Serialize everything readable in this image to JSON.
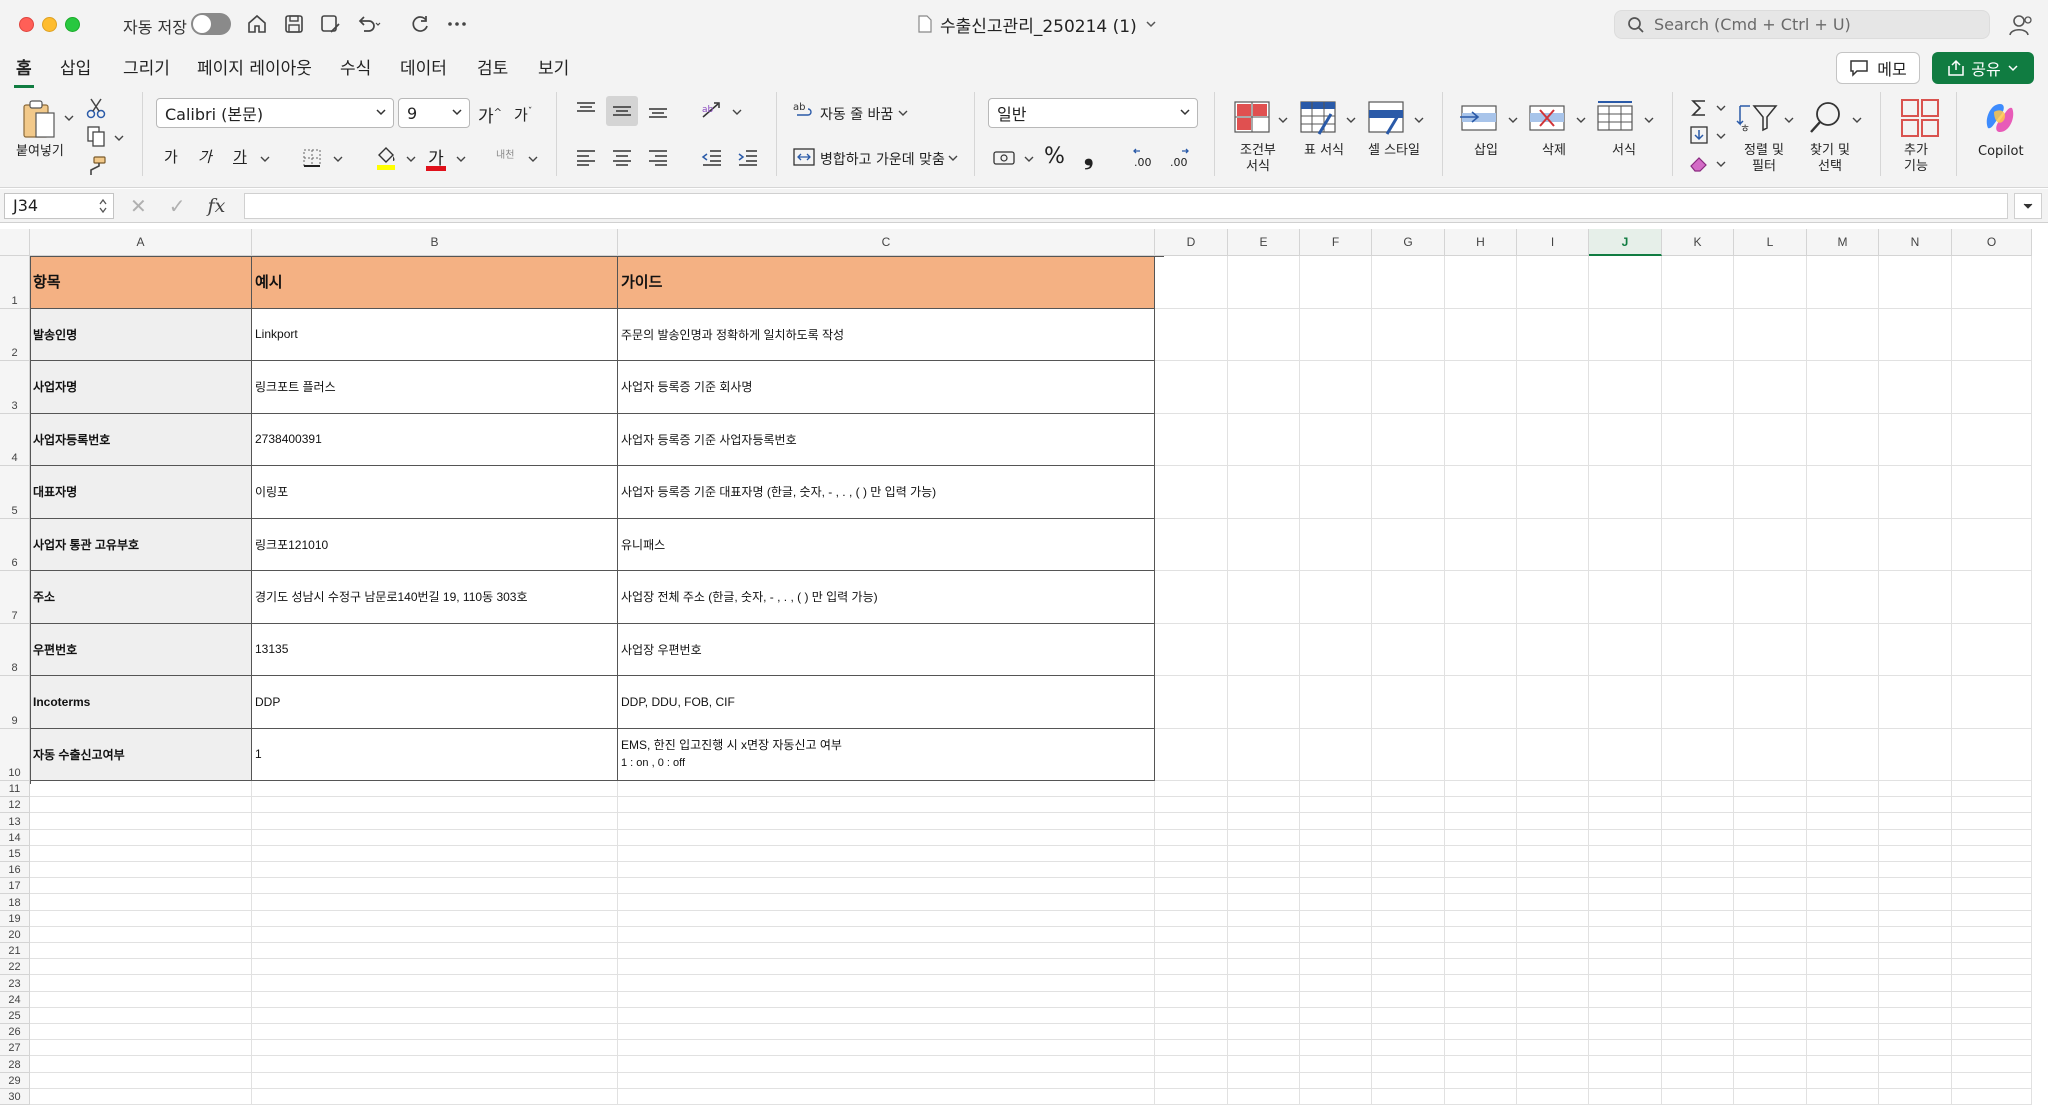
{
  "titlebar": {
    "autosave_label": "자동 저장",
    "doc_title": "수출신고관리_250214 (1)",
    "search_placeholder": "Search (Cmd + Ctrl + U)"
  },
  "tabs": [
    "홈",
    "삽입",
    "그리기",
    "페이지 레이아웃",
    "수식",
    "데이터",
    "검토",
    "보기"
  ],
  "active_tab": "홈",
  "actions": {
    "memo": "메모",
    "share": "공유"
  },
  "ribbon": {
    "paste": "붙여넣기",
    "font_name": "Calibri (본문)",
    "font_size": "9",
    "grow_font": "가",
    "shrink_font": "가",
    "bold": "가",
    "italic": "가",
    "underline": "가",
    "font_color_glyph": "가",
    "phonetic": "내천",
    "wrap_text": "자동 줄 바꿈",
    "merge_center": "병합하고 가운데 맞춤",
    "number_format": "일반",
    "percent": "%",
    "comma": "❟",
    "inc_decimal": ".00",
    "dec_decimal": ".00",
    "conditional_format": "조건부\n서식",
    "format_as_table": "표 서식",
    "cell_styles": "셀 스타일",
    "insert": "삽입",
    "delete": "삭제",
    "format": "서식",
    "sort_filter": "정렬 및\n필터",
    "find_select": "찾기 및\n선택",
    "addins": "추가\n기능",
    "copilot": "Copilot"
  },
  "formula_bar": {
    "name_box": "J34",
    "fx": "fx",
    "value": ""
  },
  "columns": [
    "A",
    "B",
    "C",
    "D",
    "E",
    "F",
    "G",
    "H",
    "I",
    "J",
    "K",
    "L",
    "M",
    "N",
    "O"
  ],
  "selected_column": "J",
  "rows": [
    "1",
    "2",
    "3",
    "4",
    "5",
    "6",
    "7",
    "8",
    "9",
    "10",
    "11",
    "12",
    "13",
    "14",
    "15",
    "16",
    "17",
    "18",
    "19",
    "20",
    "21",
    "22",
    "23",
    "24",
    "25",
    "26",
    "27",
    "28",
    "29",
    "30"
  ],
  "table": {
    "header": [
      "항목",
      "예시",
      "가이드"
    ],
    "rows": [
      [
        "발송인명",
        "Linkport",
        "주문의 발송인명과 정확하게 일치하도록 작성"
      ],
      [
        "사업자명",
        "링크포트 플러스",
        "사업자 등록증 기준 회사명"
      ],
      [
        "사업자등록번호",
        "2738400391",
        "사업자 등록증 기준 사업자등록번호"
      ],
      [
        "대표자명",
        "이링포",
        "사업자 등록증 기준 대표자명 (한글, 숫자, - , . , ( ) 만 입력 가능)"
      ],
      [
        "사업자 통관 고유부호",
        "링크포121010",
        "유니패스"
      ],
      [
        "주소",
        "경기도 성남시 수정구 남문로140번길 19, 110동 303호",
        "사업장 전체 주소 (한글, 숫자, - , . , ( ) 만 입력 가능)"
      ],
      [
        "우편번호",
        "13135",
        "사업장 우편번호"
      ],
      [
        "Incoterms",
        "DDP",
        "DDP, DDU, FOB, CIF"
      ],
      [
        "자동 수출신고여부",
        "1",
        "EMS, 한진 입고진행 시 x면장 자동신고 여부"
      ]
    ],
    "last_guide_line2": "1 : on , 0 : off"
  }
}
